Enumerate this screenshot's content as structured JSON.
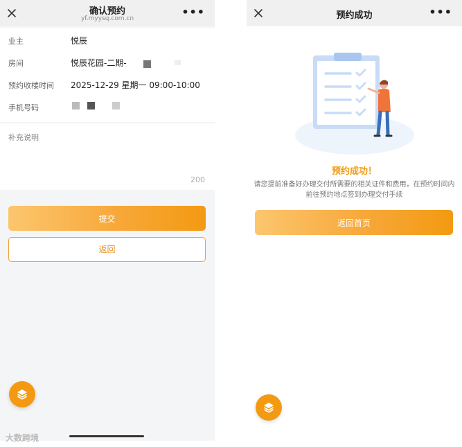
{
  "left": {
    "nav": {
      "title": "确认预约",
      "subtitle": "yf.myysq.com.cn"
    },
    "info": [
      {
        "label": "业主",
        "value": "悦辰"
      },
      {
        "label": "房间",
        "value": "悦辰花园-二期-"
      },
      {
        "label": "预约收楼时间",
        "value": "2025-12-29 星期一 09:00-10:00"
      },
      {
        "label": "手机号码",
        "value": ""
      }
    ],
    "note": {
      "placeholder": "补充说明",
      "max_count": "200"
    },
    "submit_label": "提交",
    "back_label": "返回",
    "watermark": "大数跨境"
  },
  "right": {
    "nav": {
      "title": "预约成功"
    },
    "success_title": "预约成功！",
    "success_desc": "请您提前准备好办理交付所需要的相关证件和费用，在预约时间内前往预约地点签到办理交付手续",
    "home_label": "返回首页"
  },
  "colors": {
    "accent": "#f39a12",
    "gradient_start": "#fcc66e"
  },
  "icons": [
    "close-icon",
    "more-icon",
    "layers-icon",
    "clipboard-illustration"
  ]
}
